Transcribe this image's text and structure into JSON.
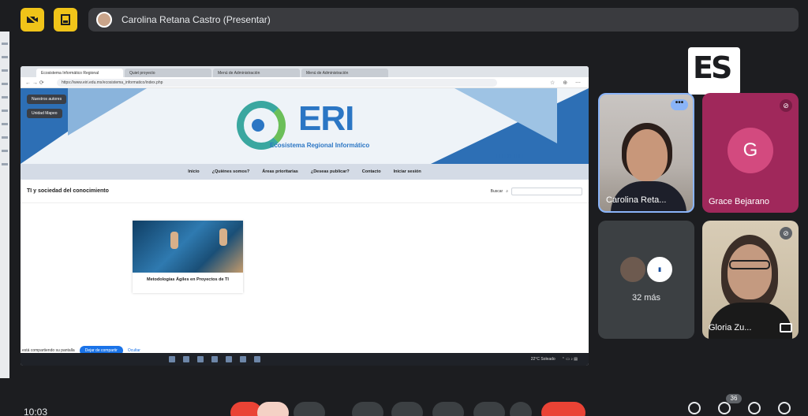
{
  "meeting": {
    "presenter_label": "Carolina Retana Castro (Presentar)",
    "clock": "10:03",
    "people_count": "36"
  },
  "browser": {
    "tabs": [
      {
        "label": "Ecosistema Informático Regional"
      },
      {
        "label": "Quiet proyecto"
      },
      {
        "label": "Menú de Administración"
      },
      {
        "label": "Menú de Administración"
      }
    ],
    "address": "https://www.eiri.edu.mx/ecosistema_informatico/index.php"
  },
  "site": {
    "pill1": "Nuestros autores",
    "pill2": "Unidad Mapeo",
    "logo_text": "ERI",
    "logo_subtitle": "Ecosistema Regional Informático",
    "nav": [
      "Inicio",
      "¿Quiénes somos?",
      "Áreas prioritarias",
      "¿Deseas publicar?",
      "Contacto",
      "Iniciar sesión"
    ],
    "section_title": "TI y sociedad del conocimiento",
    "search_label": "Buscar",
    "card_title": "Metodologías Ágiles en Proyectos de TI"
  },
  "share": {
    "notice": "está compartiendo su pantalla",
    "stop_label": "Dejar de compartir",
    "hide_label": "Ocultar"
  },
  "taskbar": {
    "weather": "22°C Soleado"
  },
  "participants": {
    "carolina": "Carolina Reta...",
    "grace": "Grace Bejarano",
    "grace_initial": "G",
    "more": "32 más",
    "gloria": "Gloria Zu..."
  }
}
